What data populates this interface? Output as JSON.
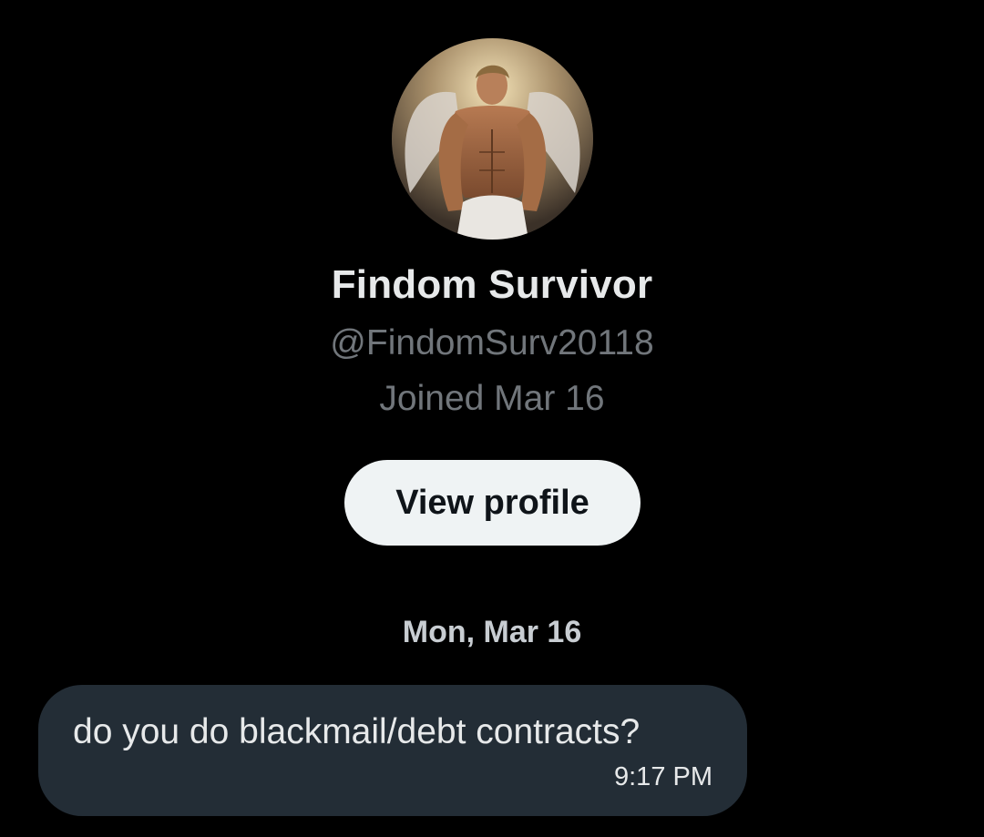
{
  "profile": {
    "avatar_icon": "angel-avatar-icon",
    "display_name": "Findom Survivor",
    "handle": "@FindomSurv20118",
    "joined": "Joined Mar 16",
    "view_profile_label": "View profile"
  },
  "conversation": {
    "date_divider": "Mon, Mar 16",
    "messages": [
      {
        "text": "do you do blackmail/debt contracts?",
        "time": "9:17 PM",
        "direction": "received"
      }
    ]
  },
  "colors": {
    "background": "#000000",
    "primary_text": "#e7e9ea",
    "secondary_text": "#71767b",
    "button_bg": "#eff3f4",
    "bubble_bg": "#232d36"
  }
}
